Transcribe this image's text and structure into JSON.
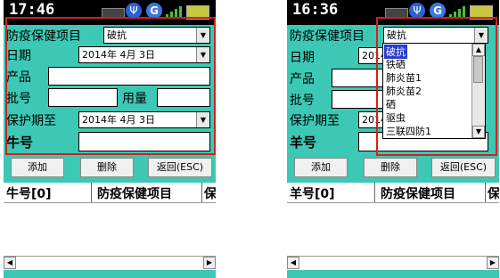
{
  "screen1": {
    "time": "17:46",
    "labels": {
      "item": "防疫保健项目",
      "date": "日期",
      "product": "产品",
      "batch": "批号",
      "dose": "用量",
      "protect": "保护期至",
      "animal": "牛号"
    },
    "values": {
      "item": "破抗",
      "date": "2014年 4月 3日",
      "protect": "2014年 4月 3日",
      "product": "",
      "batch": "",
      "dose": "",
      "animal": ""
    },
    "buttons": {
      "add": "添加",
      "delete": "删除",
      "back": "返回(ESC)"
    },
    "grid_headers": [
      "牛号[0]",
      "防疫保健项目",
      "保"
    ]
  },
  "screen2": {
    "time": "16:36",
    "labels": {
      "item": "防疫保健项目",
      "date": "日期",
      "product": "产品",
      "batch": "批号",
      "protect": "保护期至",
      "animal": "羊号"
    },
    "values": {
      "item": "破抗",
      "date_partial": "2014",
      "protect_partial": "2014"
    },
    "dropdown_options": [
      "破抗",
      "铁硒",
      "肺炎苗1",
      "肺炎苗2",
      "硒",
      "驱虫",
      "三联四防1"
    ],
    "selected_option": "破抗",
    "buttons": {
      "add": "添加",
      "delete": "删除",
      "back": "返回(ESC)"
    },
    "grid_headers": [
      "羊号[0]",
      "防疫保健项目",
      "保"
    ]
  },
  "colors": {
    "background": "#3cc8b4",
    "highlight": "#d42020",
    "selection": "#2a3bd0"
  },
  "icons": [
    "keyboard-icon",
    "usb-icon",
    "gps-icon",
    "signal-icon",
    "battery-icon"
  ]
}
